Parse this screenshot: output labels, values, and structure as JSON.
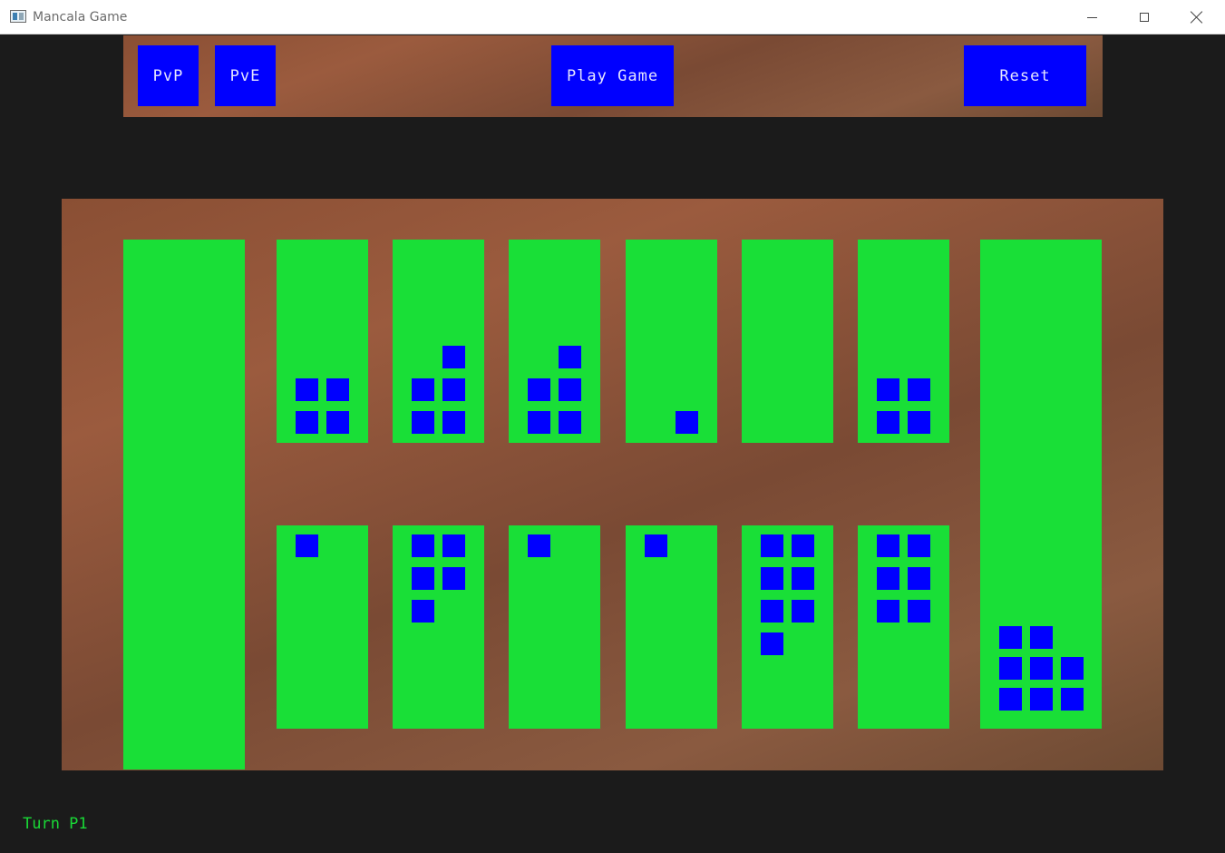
{
  "window": {
    "title": "Mancala Game",
    "icon": "app-window-icon",
    "controls": [
      "minimize-icon",
      "maximize-icon",
      "close-icon"
    ]
  },
  "toolbar": {
    "pvp_label": "PvP",
    "pve_label": "PvE",
    "play_label": "Play Game",
    "reset_label": "Reset"
  },
  "colors": {
    "background": "#1b1b1b",
    "board": "#8a5a40",
    "pit": "#19df37",
    "stone": "#0000ff",
    "button": "#0000ff",
    "turn_text": "#19d936"
  },
  "board": {
    "left_store": {
      "stones": 0
    },
    "right_store": {
      "stones": 8
    },
    "top_pits": [
      {
        "stones": 4
      },
      {
        "stones": 5
      },
      {
        "stones": 5
      },
      {
        "stones": 1
      },
      {
        "stones": 0
      },
      {
        "stones": 4
      }
    ],
    "bottom_pits": [
      {
        "stones": 1
      },
      {
        "stones": 5
      },
      {
        "stones": 1
      },
      {
        "stones": 1
      },
      {
        "stones": 7
      },
      {
        "stones": 6
      }
    ]
  },
  "status": {
    "turn_text": "Turn P1"
  }
}
